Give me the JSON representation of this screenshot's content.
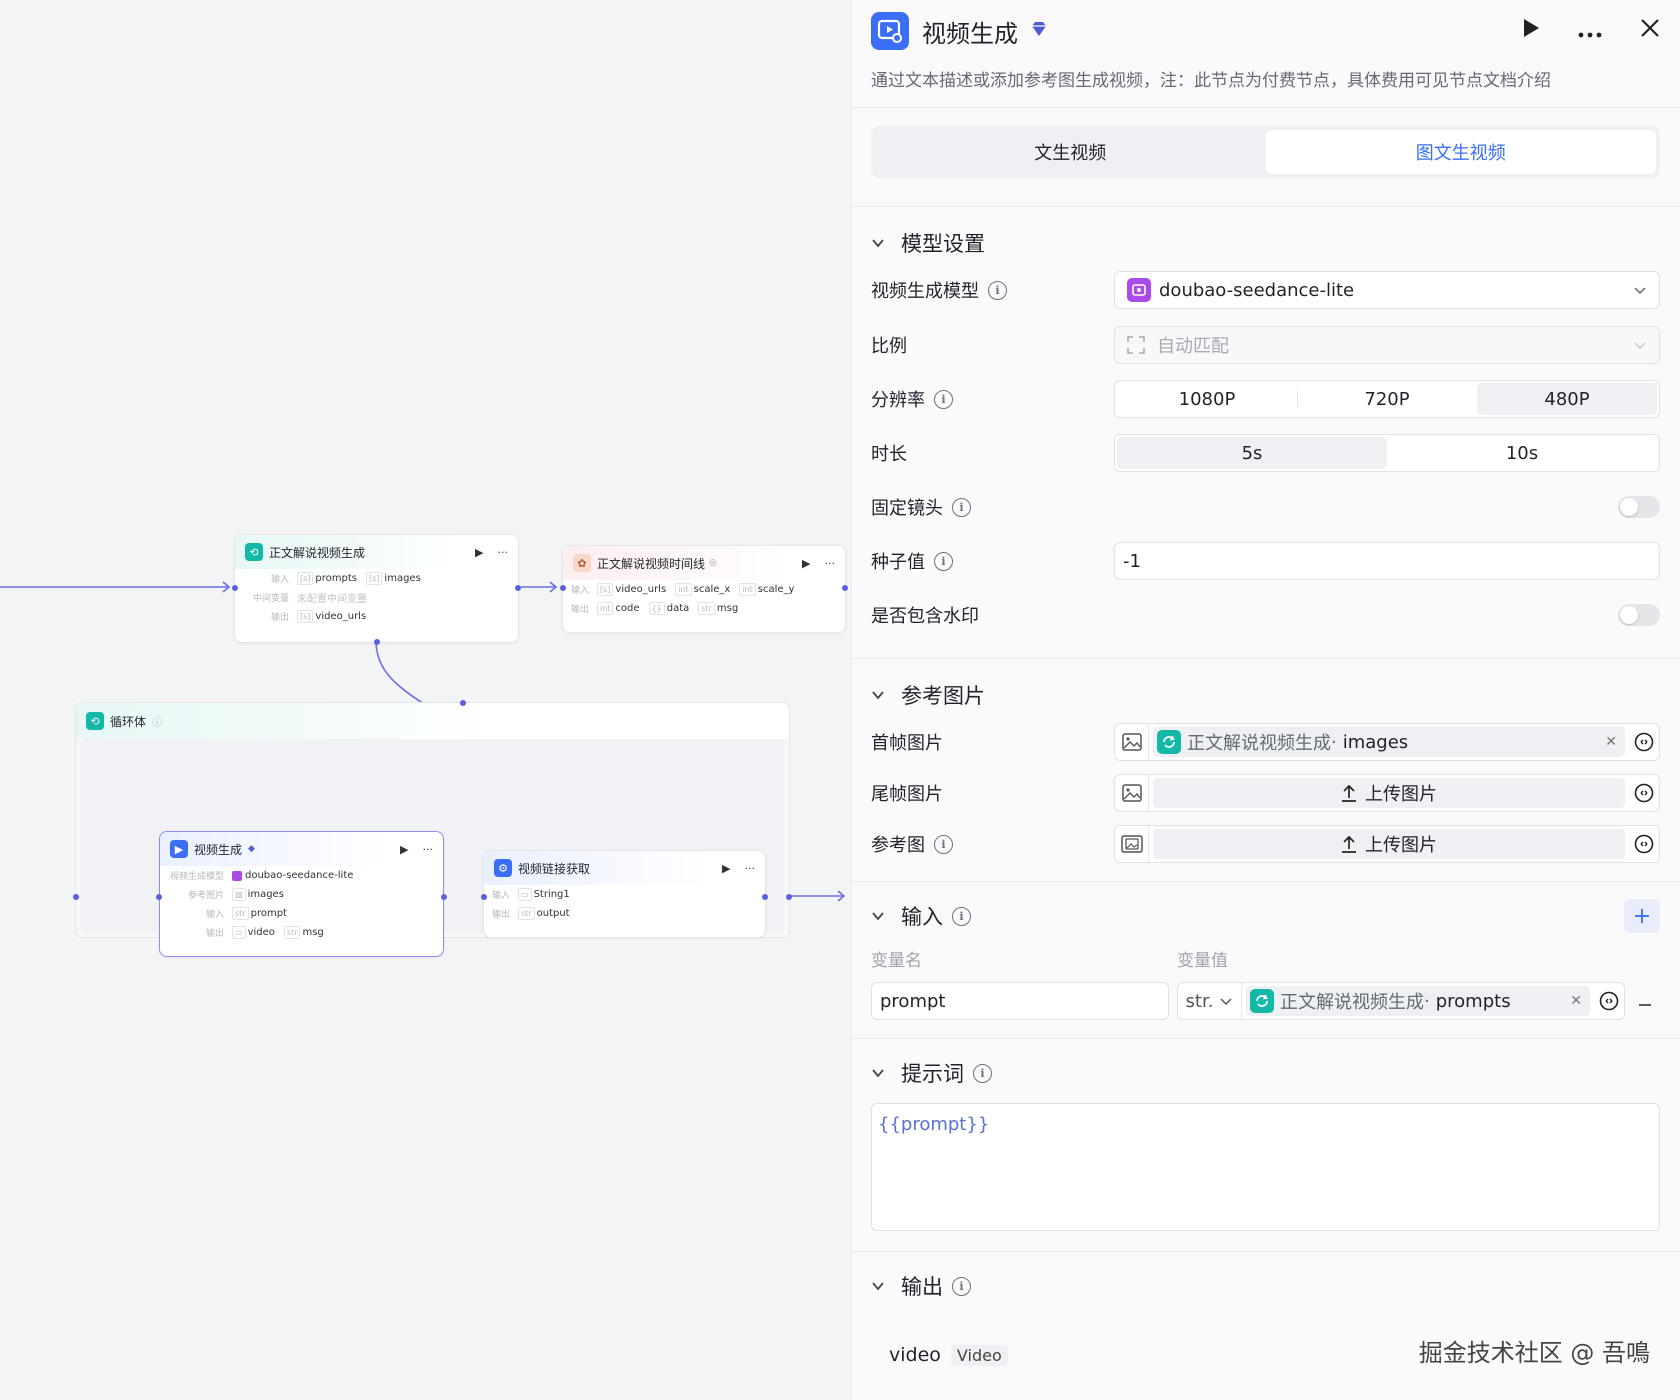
{
  "canvas": {
    "node1": {
      "title": "正文解说视频生成",
      "input_label": "输入",
      "input_vars": [
        "prompts",
        "images"
      ],
      "input_types": [
        "[s]",
        "[s]"
      ],
      "mid_label": "中间变量",
      "mid_value": "未配置中间变量",
      "output_label": "输出",
      "output_vars": [
        "video_urls"
      ],
      "output_types": [
        "[s]"
      ]
    },
    "node2": {
      "title": "正文解说视频时间线",
      "input_label": "输入",
      "input_vars": [
        "video_urls",
        "scale_x",
        "scale_y"
      ],
      "input_types": [
        "[s]",
        "int",
        "int"
      ],
      "output_label": "输出",
      "output_vars": [
        "code",
        "data",
        "msg"
      ],
      "output_types": [
        "int",
        "{}",
        "str"
      ]
    },
    "loop": {
      "title": "循环体"
    },
    "node3": {
      "title": "视频生成",
      "model_label": "视频生成模型",
      "model_value": "doubao-seedance-lite",
      "ref_label": "参考图片",
      "ref_value": "images",
      "input_label": "输入",
      "input_vars": [
        "prompt"
      ],
      "input_types": [
        "str"
      ],
      "output_label": "输出",
      "output_vars": [
        "video",
        "msg"
      ],
      "output_types": [
        "▭",
        "str"
      ]
    },
    "node4": {
      "title": "视频链接获取",
      "input_label": "输入",
      "input_vars": [
        "String1"
      ],
      "input_types": [
        "▭"
      ],
      "output_label": "输出",
      "output_vars": [
        "output"
      ],
      "output_types": [
        "str"
      ]
    }
  },
  "panel": {
    "title": "视频生成",
    "description": "通过文本描述或添加参考图生成视频，注：此节点为付费节点，具体费用可见节点文档介绍",
    "tabs": [
      "文生视频",
      "图文生视频"
    ],
    "active_tab": 1,
    "model_section": {
      "title": "模型设置",
      "model_label": "视频生成模型",
      "model_value": "doubao-seedance-lite",
      "ratio_label": "比例",
      "ratio_value": "自动匹配",
      "resolution_label": "分辨率",
      "resolutions": [
        "1080P",
        "720P",
        "480P"
      ],
      "resolution_selected": "480P",
      "duration_label": "时长",
      "durations": [
        "5s",
        "10s"
      ],
      "duration_selected": "5s",
      "fixed_camera_label": "固定镜头",
      "fixed_camera_on": false,
      "seed_label": "种子值",
      "seed_value": "-1",
      "watermark_label": "是否包含水印",
      "watermark_on": false
    },
    "ref_section": {
      "title": "参考图片",
      "first_frame_label": "首帧图片",
      "first_frame_ref_node": "正文解说视频生成",
      "first_frame_ref_var": "images",
      "last_frame_label": "尾帧图片",
      "upload_label": "上传图片",
      "ref_image_label": "参考图"
    },
    "input_section": {
      "title": "输入",
      "col_name": "变量名",
      "col_value": "变量值",
      "rows": [
        {
          "name": "prompt",
          "type": "str.",
          "ref_node": "正文解说视频生成",
          "ref_var": "prompts"
        }
      ]
    },
    "prompt_section": {
      "title": "提示词",
      "value": "{{prompt}}"
    },
    "output_section": {
      "title": "输出",
      "name": "video",
      "type": "Video"
    },
    "watermark_text": "掘金技术社区 @ 吾鳴"
  },
  "colors": {
    "accent": "#3b6ef6",
    "teal": "#14b8a6",
    "wire": "#5b5fe0",
    "gem": "#4f5bd5"
  }
}
